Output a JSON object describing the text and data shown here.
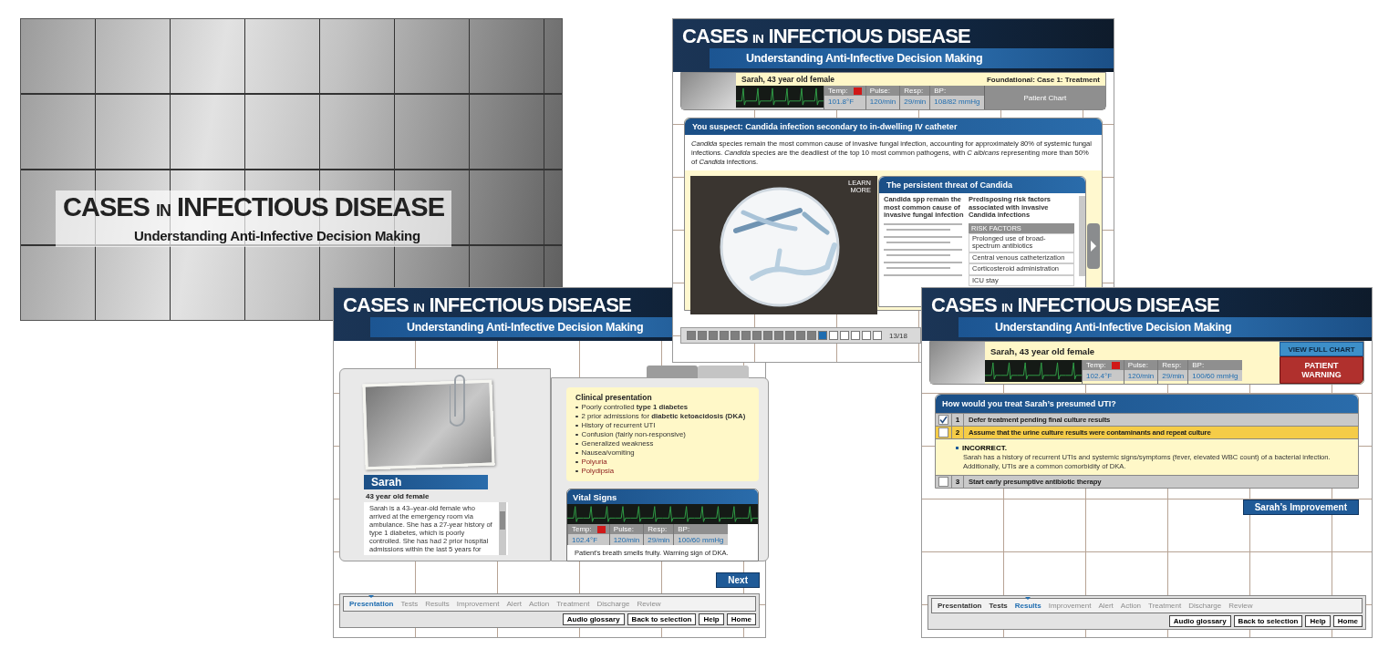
{
  "screens": [
    {
      "kind": "cover",
      "title": "CASES $_{IN}$ INFECTIOUS DISEASE",
      "subtitle": "Understanding Anti-Infective Decision Making"
    },
    {
      "kind": "presentation",
      "title": "CASES $_{IN}$ INFECTIOUS DISEASE",
      "subtitle": "Understanding Anti-Infective Decision Making",
      "patient": {
        "name": "Sarah",
        "age": "43 year old female",
        "bio": "Sarah is a 43–year-old female who arrived at the emergency room via ambulance. She has a 27-year history of type 1 diabetes, which is poorly controlled. She has had 2 prior hospital admissions within the last 5 years for"
      },
      "clinical": {
        "heading": "Clinical presentation",
        "items": [
          {
            "text": "Poorly controlled **type 1 diabetes**",
            "highlight": false
          },
          {
            "text": "2 prior admissions for **diabetic ketoacidosis (DKA)**",
            "highlight": false
          },
          {
            "text": "History of recurrent UTI",
            "highlight": false
          },
          {
            "text": "Confusion (fairly non-responsive)",
            "highlight": false
          },
          {
            "text": "Generalized weakness",
            "highlight": false
          },
          {
            "text": "Nausea/vomiting",
            "highlight": false
          },
          {
            "text": "Polyuria",
            "highlight": true
          },
          {
            "text": "Polydipsia",
            "highlight": true
          }
        ]
      },
      "vital_signs": {
        "title": "Vital Signs",
        "vitals": [
          {
            "label": "Temp:",
            "value": "102.4°F",
            "alert": true
          },
          {
            "label": "Pulse:",
            "value": "120/min",
            "alert": false
          },
          {
            "label": "Resp:",
            "value": "29/min",
            "alert": false
          },
          {
            "label": "BP:",
            "value": "100/60 mmHg",
            "alert": false
          }
        ],
        "note": "Patient's breath smells fruity. Warning sign of DKA."
      },
      "next_button": "Next",
      "nav": {
        "tabs": [
          {
            "label": "Presentation",
            "selected": true,
            "disabled": false
          },
          {
            "label": "Tests",
            "selected": false,
            "disabled": true
          },
          {
            "label": "Results",
            "selected": false,
            "disabled": true
          },
          {
            "label": "Improvement",
            "selected": false,
            "disabled": true
          },
          {
            "label": "Alert",
            "selected": false,
            "disabled": true
          },
          {
            "label": "Action",
            "selected": false,
            "disabled": true
          },
          {
            "label": "Treatment",
            "selected": false,
            "disabled": true
          },
          {
            "label": "Discharge",
            "selected": false,
            "disabled": true
          },
          {
            "label": "Review",
            "selected": false,
            "disabled": true
          }
        ],
        "buttons": [
          "Audio glossary",
          "Back to selection",
          "Help",
          "Home"
        ]
      }
    },
    {
      "kind": "candida",
      "title": "CASES $_{IN}$ INFECTIOUS DISEASE",
      "subtitle": "Understanding Anti-Infective Decision Making",
      "patient": {
        "name": "Sarah, 43 year old female",
        "case": "Foundational: Case 1: Treatment",
        "vitals": [
          {
            "label": "Temp:",
            "value": "101.8°F",
            "alert": true
          },
          {
            "label": "Pulse:",
            "value": "120/min",
            "alert": false
          },
          {
            "label": "Resp:",
            "value": "29/min",
            "alert": false
          },
          {
            "label": "BP:",
            "value": "108/82 mmHg",
            "alert": false
          }
        ],
        "chart_button": "Patient Chart"
      },
      "suspect": "You suspect: Candida infection secondary to in-dwelling IV catheter",
      "intro": "*Candida* species remain the most common cause of invasive fungal infection, accounting for approximately 80% of systemic fungal infections. *Candida* species are the deadliest of the top 10 most common pathogens, with *C albicans* representing more than 50% of *Candida* infections.",
      "learn_more": "LEARN MORE",
      "panel": {
        "title": "The persistent threat of Candida",
        "left_heading": "Candida spp remain the most common cause of invasive fungal infection",
        "right_heading": "Predisposing risk factors associated with invasive Candida infections",
        "risk_header": "RISK FACTORS",
        "risk_rows": [
          "Prolonged use of broad-spectrum antibiotics",
          "Central venous catheterization",
          "Corticosteroid administration",
          "ICU stay"
        ]
      },
      "progress": {
        "steps": [
          {
            "done": true,
            "selected": false
          },
          {
            "done": true,
            "selected": false
          },
          {
            "done": true,
            "selected": false
          },
          {
            "done": true,
            "selected": false
          },
          {
            "done": true,
            "selected": false
          },
          {
            "done": true,
            "selected": false
          },
          {
            "done": true,
            "selected": false
          },
          {
            "done": true,
            "selected": false
          },
          {
            "done": true,
            "selected": false
          },
          {
            "done": true,
            "selected": false
          },
          {
            "done": true,
            "selected": false
          },
          {
            "done": true,
            "selected": false
          },
          {
            "done": false,
            "selected": true
          },
          {
            "done": false,
            "selected": false
          },
          {
            "done": false,
            "selected": false
          },
          {
            "done": false,
            "selected": false
          },
          {
            "done": false,
            "selected": false
          },
          {
            "done": false,
            "selected": false
          }
        ],
        "label": "13/18"
      }
    },
    {
      "kind": "treatment",
      "title": "CASES $_{IN}$ INFECTIOUS DISEASE",
      "subtitle": "Understanding Anti-Infective Decision Making",
      "patient": {
        "name": "Sarah, 43 year old female",
        "vitals": [
          {
            "label": "Temp:",
            "value": "102.4°F",
            "alert": true
          },
          {
            "label": "Pulse:",
            "value": "120/min",
            "alert": false
          },
          {
            "label": "Resp:",
            "value": "29/min",
            "alert": false
          },
          {
            "label": "BP:",
            "value": "100/60 mmHg",
            "alert": false
          }
        ],
        "chart_button": "VIEW FULL CHART",
        "warning_button": "PATIENT WARNING"
      },
      "question": "How would you treat Sarah’s presumed UTI?",
      "options": [
        {
          "number": "1",
          "label": "Defer treatment pending final culture results",
          "checked": true,
          "selected": false
        },
        {
          "number": "2",
          "label": "Assume that the urine culture results were contaminants and repeat culture",
          "checked": false,
          "selected": true,
          "feedback": {
            "heading": "INCORRECT.",
            "text": "Sarah has a history of recurrent UTIs and systemic signs/symptoms (fever, elevated WBC count) of a bacterial infection. Additionally, UTIs are a common comorbidity of DKA."
          }
        },
        {
          "number": "3",
          "label": "Start early presumptive antibiotic therapy",
          "checked": false,
          "selected": false
        }
      ],
      "next_button": "Sarah’s Improvement",
      "nav": {
        "tabs": [
          {
            "label": "Presentation",
            "selected": false,
            "disabled": false
          },
          {
            "label": "Tests",
            "selected": false,
            "disabled": false
          },
          {
            "label": "Results",
            "selected": true,
            "disabled": false
          },
          {
            "label": "Improvement",
            "selected": false,
            "disabled": true
          },
          {
            "label": "Alert",
            "selected": false,
            "disabled": true
          },
          {
            "label": "Action",
            "selected": false,
            "disabled": true
          },
          {
            "label": "Treatment",
            "selected": false,
            "disabled": true
          },
          {
            "label": "Discharge",
            "selected": false,
            "disabled": true
          },
          {
            "label": "Review",
            "selected": false,
            "disabled": true
          }
        ],
        "buttons": [
          "Audio glossary",
          "Back to selection",
          "Help",
          "Home"
        ]
      }
    }
  ]
}
